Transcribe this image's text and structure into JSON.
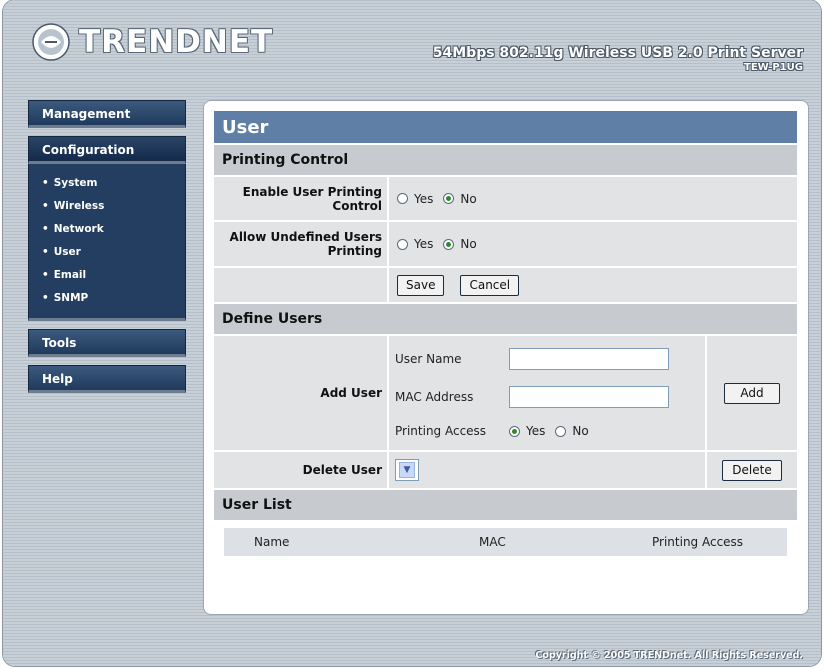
{
  "header": {
    "brand": "TRENDNET",
    "product_title": "54Mbps 802.11g Wireless USB 2.0 Print Server",
    "model": "TEW-P1UG"
  },
  "nav": {
    "management": "Management",
    "configuration": "Configuration",
    "sub_items": [
      "System",
      "Wireless",
      "Network",
      "User",
      "Email",
      "SNMP"
    ],
    "tools": "Tools",
    "help": "Help"
  },
  "page": {
    "title": "User",
    "printing_control": {
      "heading": "Printing Control",
      "enable_label": "Enable User Printing Control",
      "allow_label": "Allow Undefined Users Printing",
      "yes": "Yes",
      "no": "No",
      "enable_selected": "No",
      "allow_selected": "No",
      "save_label": "Save",
      "cancel_label": "Cancel"
    },
    "define_users": {
      "heading": "Define Users",
      "add_user_label": "Add User",
      "user_name_label": "User Name",
      "user_name_value": "",
      "mac_label": "MAC Address",
      "mac_value": "",
      "access_label": "Printing Access",
      "yes": "Yes",
      "no": "No",
      "access_selected": "Yes",
      "add_button": "Add",
      "delete_user_label": "Delete User",
      "delete_select_value": "",
      "delete_button": "Delete"
    },
    "user_list": {
      "heading": "User List",
      "columns": [
        "Name",
        "MAC",
        "Printing Access"
      ]
    }
  },
  "footer": {
    "copyright": "Copyright © 2005 TRENDnet. All Rights Reserved."
  },
  "colors": {
    "title_bar": "#5f7fa6",
    "section_bar": "#c7cbd0",
    "nav_button": "#1f3a5c",
    "radio_selected": "#2c8a2c"
  }
}
